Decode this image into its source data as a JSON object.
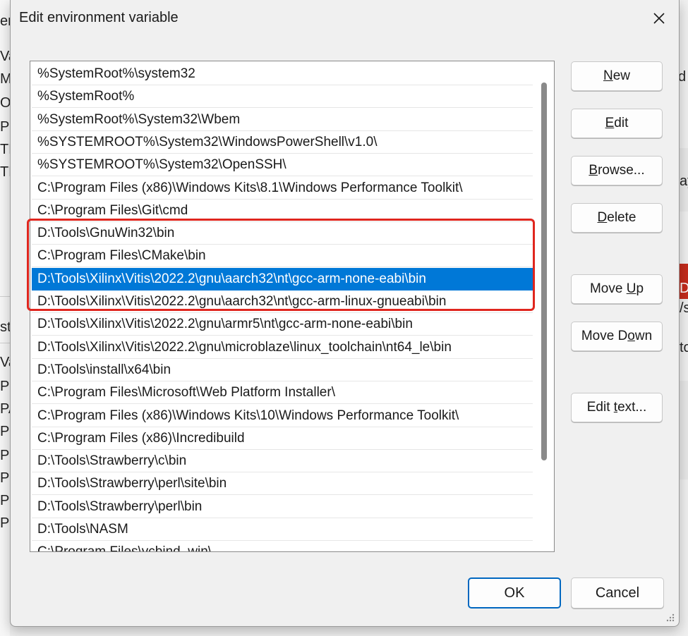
{
  "dialog": {
    "title": "Edit environment variable",
    "close_glyph": "✕"
  },
  "path_entries": [
    "%SystemRoot%\\system32",
    "%SystemRoot%",
    "%SystemRoot%\\System32\\Wbem",
    "%SYSTEMROOT%\\System32\\WindowsPowerShell\\v1.0\\",
    "%SYSTEMROOT%\\System32\\OpenSSH\\",
    "C:\\Program Files (x86)\\Windows Kits\\8.1\\Windows Performance Toolkit\\",
    "C:\\Program Files\\Git\\cmd",
    "D:\\Tools\\GnuWin32\\bin",
    "C:\\Program Files\\CMake\\bin",
    "D:\\Tools\\Xilinx\\Vitis\\2022.2\\gnu\\aarch32\\nt\\gcc-arm-none-eabi\\bin",
    "D:\\Tools\\Xilinx\\Vitis\\2022.2\\gnu\\aarch32\\nt\\gcc-arm-linux-gnueabi\\bin",
    "D:\\Tools\\Xilinx\\Vitis\\2022.2\\gnu\\armr5\\nt\\gcc-arm-none-eabi\\bin",
    "D:\\Tools\\Xilinx\\Vitis\\2022.2\\gnu\\microblaze\\linux_toolchain\\nt64_le\\bin",
    "D:\\Tools\\install\\x64\\bin",
    "C:\\Program Files\\Microsoft\\Web Platform Installer\\",
    "C:\\Program Files (x86)\\Windows Kits\\10\\Windows Performance Toolkit\\",
    "C:\\Program Files (x86)\\Incredibuild",
    "D:\\Tools\\Strawberry\\c\\bin",
    "D:\\Tools\\Strawberry\\perl\\site\\bin",
    "D:\\Tools\\Strawberry\\perl\\bin",
    "D:\\Tools\\NASM",
    "C:\\Program Files\\vcbind_win\\"
  ],
  "selected_index": 9,
  "highlighted_range": [
    7,
    10
  ],
  "buttons": {
    "new": {
      "pre": "",
      "key": "N",
      "post": "ew"
    },
    "edit": {
      "pre": "",
      "key": "E",
      "post": "dit"
    },
    "browse": {
      "pre": "",
      "key": "B",
      "post": "rowse..."
    },
    "delete": {
      "pre": "",
      "key": "D",
      "post": "elete"
    },
    "move_up": {
      "pre": "Move ",
      "key": "U",
      "post": "p"
    },
    "move_down": {
      "pre": "Move D",
      "key": "o",
      "post": "wn"
    },
    "edit_text": {
      "pre": "Edit ",
      "key": "t",
      "post": "ext..."
    },
    "ok": "OK",
    "cancel": "Cancel"
  },
  "background": {
    "left_fragments": [
      "er",
      "Va",
      "MC",
      "Or",
      "Pa",
      "TE",
      "TM",
      "ste",
      "Va",
      "Pa",
      "PA",
      "PR",
      "PR",
      "PR",
      "PR",
      "PS"
    ],
    "right_fragments": [
      "d",
      "ay",
      "D",
      "/s",
      "to"
    ]
  },
  "colors": {
    "selection": "#0078d7",
    "highlight_border": "#e0261e",
    "default_button_border": "#0067c0"
  }
}
